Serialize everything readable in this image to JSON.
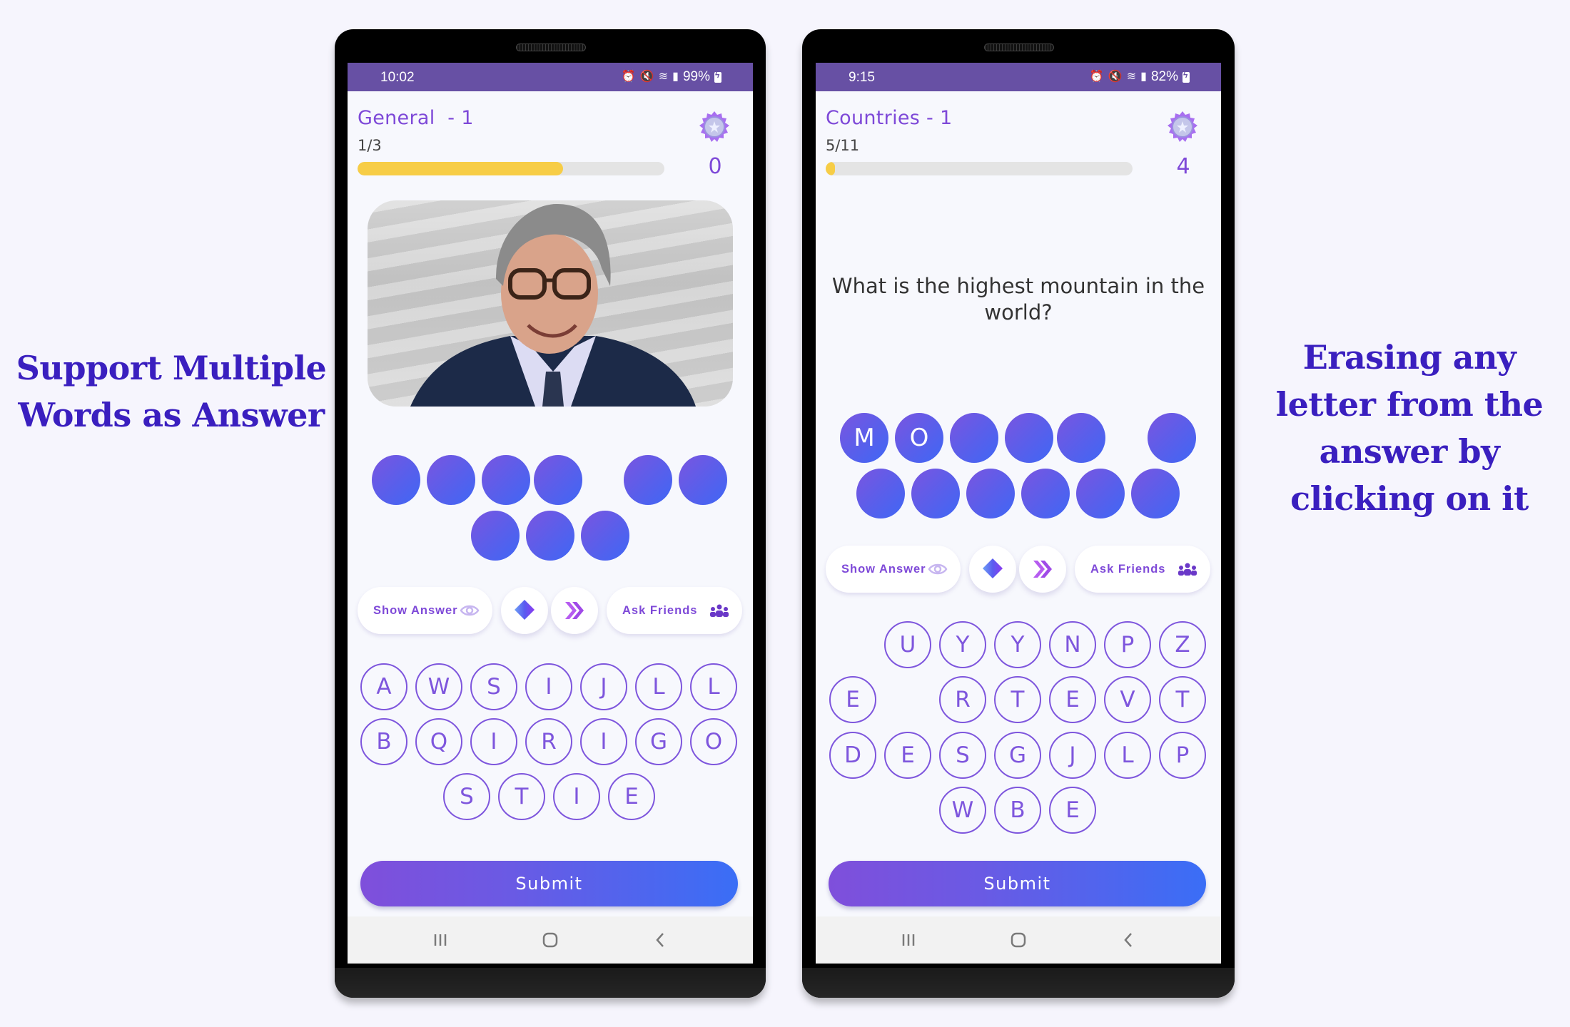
{
  "captions": {
    "left": "Support Multiple Words as Answer",
    "right": "Erasing any letter from the answer by clicking on it"
  },
  "phones": [
    {
      "status": {
        "time": "10:02",
        "battery": "99%",
        "icons": [
          "alarm-icon",
          "mute-icon",
          "wifi-icon",
          "signal-icon",
          "battery-charging-icon"
        ]
      },
      "header": {
        "level_title": "General  - 1",
        "progress_text": "1/3",
        "progress_fraction": 0.67,
        "score": "0",
        "medal_icon": "medal-badge-icon"
      },
      "question": {
        "type": "image",
        "image_description": "Portrait photo of a smiling man with glasses in a dark suit"
      },
      "answer_slots": {
        "rows": [
          [
            {
              "letter": ""
            },
            {
              "letter": ""
            },
            {
              "letter": ""
            },
            {
              "letter": ""
            },
            {
              "gap": true
            },
            {
              "letter": ""
            },
            {
              "letter": ""
            }
          ],
          [
            {
              "letter": ""
            },
            {
              "letter": ""
            },
            {
              "letter": ""
            }
          ]
        ]
      },
      "helpers": {
        "show_answer": "Show Answer",
        "ask_friends": "Ask Friends",
        "eraser_icon": "eraser-icon",
        "skip_icon": "skip-icon"
      },
      "keyboard": {
        "rows": [
          [
            "A",
            "W",
            "S",
            "I",
            "J",
            "L",
            "L"
          ],
          [
            "B",
            "Q",
            "I",
            "R",
            "I",
            "G",
            "O"
          ],
          [
            "S",
            "T",
            "I",
            "E"
          ]
        ]
      },
      "submit_label": "Submit"
    },
    {
      "status": {
        "time": "9:15",
        "battery": "82%",
        "icons": [
          "alarm-icon",
          "mute-icon",
          "wifi-icon",
          "signal-icon",
          "battery-charging-icon"
        ]
      },
      "header": {
        "level_title": "Countries - 1",
        "progress_text": "5/11",
        "progress_fraction": 0.03,
        "score": "4",
        "medal_icon": "medal-badge-icon"
      },
      "question": {
        "type": "text",
        "text": "What is the highest mountain in the world?"
      },
      "answer_slots": {
        "rows": [
          [
            {
              "letter": "M"
            },
            {
              "letter": "O"
            },
            {
              "letter": ""
            },
            {
              "letter": ""
            },
            {
              "letter": ""
            },
            {
              "gap": true
            },
            {
              "letter": ""
            }
          ],
          [
            {
              "letter": ""
            },
            {
              "letter": ""
            },
            {
              "letter": ""
            },
            {
              "letter": ""
            },
            {
              "letter": ""
            },
            {
              "letter": ""
            }
          ]
        ]
      },
      "helpers": {
        "show_answer": "Show Answer",
        "ask_friends": "Ask Friends",
        "eraser_icon": "eraser-icon",
        "skip_icon": "skip-icon"
      },
      "keyboard": {
        "rows": [
          [
            "",
            "U",
            "Y",
            "Y",
            "N",
            "P",
            "Z"
          ],
          [
            "E",
            "",
            "R",
            "T",
            "E",
            "V",
            "T"
          ],
          [
            "D",
            "E",
            "S",
            "G",
            "J",
            "L",
            "P"
          ],
          [
            "W",
            "B",
            "E"
          ]
        ]
      },
      "submit_label": "Submit"
    }
  ],
  "colors": {
    "accent": "#7e49d8",
    "status_bar": "#6750a4",
    "progress_fill": "#f7cd46",
    "caption": "#3a1fbf",
    "submit_gradient": [
      "#7f4fdb",
      "#3a6ef6"
    ]
  }
}
